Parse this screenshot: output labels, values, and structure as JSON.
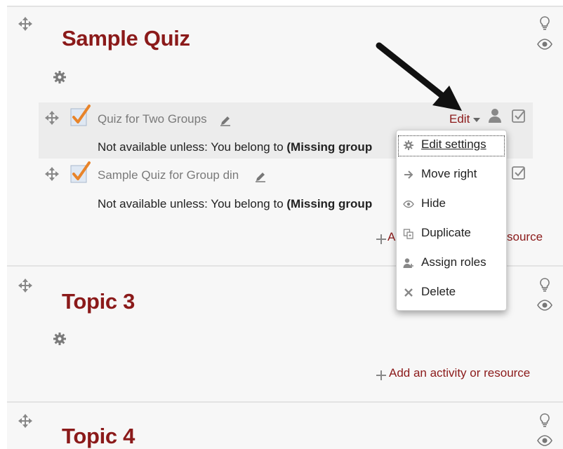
{
  "sections": [
    {
      "title": "Sample Quiz"
    },
    {
      "title": "Topic 3"
    },
    {
      "title": "Topic 4"
    }
  ],
  "activities": [
    {
      "name": "Quiz for Two Groups",
      "restriction_prefix": "Not available unless: You belong to ",
      "restriction_bold": "(Missing group"
    },
    {
      "name": "Sample Quiz for Group din",
      "restriction_prefix": "Not available unless: You belong to ",
      "restriction_bold": "(Missing group"
    }
  ],
  "edit_label": "Edit",
  "add_activity_full": "Add an activity or resource",
  "add_activity_left": "A",
  "add_activity_right": "source",
  "edit_menu": [
    {
      "label": "Edit settings",
      "icon": "gear-icon"
    },
    {
      "label": "Move right",
      "icon": "arrow-right-icon"
    },
    {
      "label": "Hide",
      "icon": "eye-icon"
    },
    {
      "label": "Duplicate",
      "icon": "duplicate-icon"
    },
    {
      "label": "Assign roles",
      "icon": "assign-roles-icon"
    },
    {
      "label": "Delete",
      "icon": "delete-icon"
    }
  ],
  "colors": {
    "accent": "#8b1a1a",
    "highlight_row": "#ececec",
    "section_bg": "#f7f7f7"
  }
}
